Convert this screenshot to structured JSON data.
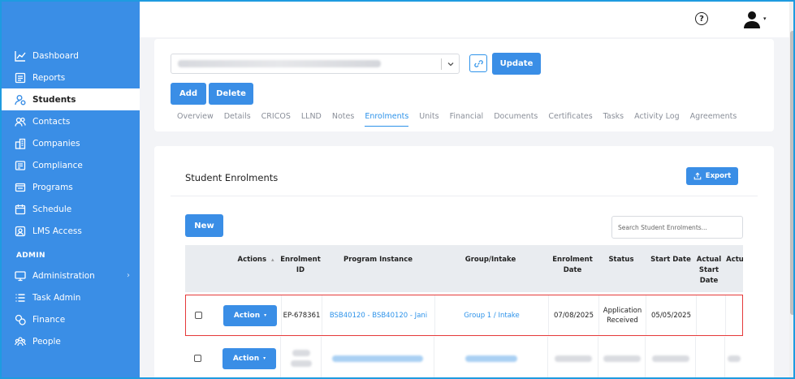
{
  "sidebar": {
    "items": [
      {
        "label": "Dashboard",
        "icon": "chart-line-icon"
      },
      {
        "label": "Reports",
        "icon": "report-icon"
      },
      {
        "label": "Students",
        "icon": "student-icon",
        "active": true
      },
      {
        "label": "Contacts",
        "icon": "contacts-icon"
      },
      {
        "label": "Companies",
        "icon": "building-icon"
      },
      {
        "label": "Compliance",
        "icon": "compliance-icon"
      },
      {
        "label": "Programs",
        "icon": "programs-icon"
      },
      {
        "label": "Schedule",
        "icon": "calendar-icon"
      },
      {
        "label": "LMS Access",
        "icon": "lms-icon"
      }
    ],
    "admin_label": "ADMIN",
    "admin_items": [
      {
        "label": "Administration",
        "icon": "admin-icon",
        "chevron": "›"
      },
      {
        "label": "Task Admin",
        "icon": "task-list-icon"
      },
      {
        "label": "Finance",
        "icon": "finance-icon"
      },
      {
        "label": "People",
        "icon": "people-icon"
      }
    ]
  },
  "header": {
    "help_icon": "help-icon",
    "help_glyph": "?",
    "user_icon": "user-icon",
    "user_caret": "▾"
  },
  "student_panel": {
    "update_label": "Update",
    "add_label": "Add",
    "delete_label": "Delete",
    "tabs": [
      "Overview",
      "Details",
      "CRICOS",
      "LLND",
      "Notes",
      "Enrolments",
      "Units",
      "Financial",
      "Documents",
      "Certificates",
      "Tasks",
      "Activity Log",
      "Agreements"
    ],
    "active_tab": "Enrolments"
  },
  "enrolments": {
    "title": "Student Enrolments",
    "export_label": "Export",
    "new_label": "New",
    "search_placeholder": "Search Student Enrolments...",
    "columns": {
      "actions": "Actions",
      "actions_sort": "▴",
      "enrolment_id": "Enrolment ID",
      "program_instance": "Program Instance",
      "group_intake": "Group/Intake",
      "enrolment_date": "Enrolment Date",
      "status": "Status",
      "start_date": "Start Date",
      "actual_start_date": "Actual Start Date",
      "actual_partial": "Actu D"
    },
    "rows": [
      {
        "action_label": "Action",
        "enrolment_id": "EP-678361",
        "program_instance": "BSB40120 - BSB40120 - Jani",
        "group_intake": "Group 1 / Intake",
        "enrolment_date": "07/08/2025",
        "status": "Application Received",
        "start_date": "05/05/2025"
      },
      {
        "action_label": "Action"
      }
    ]
  },
  "colors": {
    "sidebar": "#3a8ee6",
    "accent": "#2e93ea",
    "highlight_border": "#e5393a"
  }
}
